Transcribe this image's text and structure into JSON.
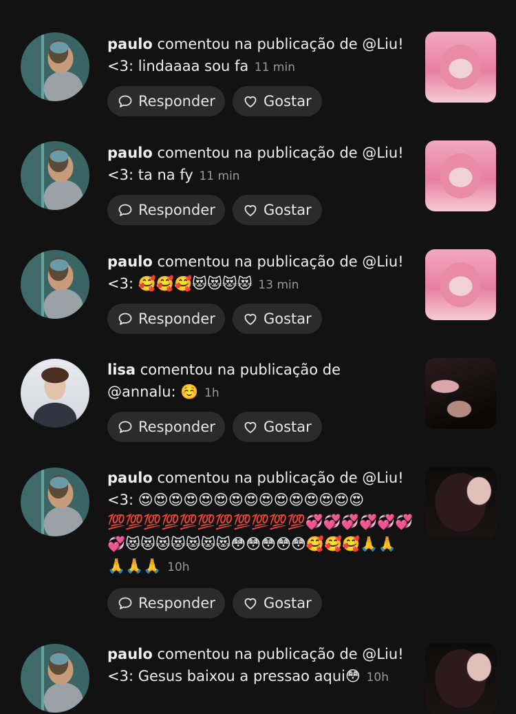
{
  "reply_label": "Responder",
  "like_label": "Gostar",
  "notifications": [
    {
      "user": "paulo",
      "action": "comentou na publicação de @Liu!",
      "comment": "<3: lindaaaa sou fa",
      "time": "11 min",
      "avatar": "paulo",
      "thumb": "pink"
    },
    {
      "user": "paulo",
      "action": "comentou na publicação de @Liu!",
      "comment": "<3: ta na fy",
      "time": "11 min",
      "avatar": "paulo",
      "thumb": "pink"
    },
    {
      "user": "paulo",
      "action": "comentou na publicação de @Liu!",
      "comment": "<3: 🥰🥰🥰😻😻😻😻",
      "time": "13 min",
      "avatar": "paulo",
      "thumb": "pink"
    },
    {
      "user": "lisa",
      "action": "comentou na publicação de",
      "comment": "@annalu: ☺️",
      "time": "1h",
      "avatar": "lisa",
      "thumb": "dark1"
    },
    {
      "user": "paulo",
      "action": "comentou na publicação de @Liu!",
      "comment": "<3: 😍😍😍😍😍😍😍😍😍😍😍😍😍😍😍💯💯💯💯💯💯💯💯💯💯💯💞💞💞💞💞💞💞😻😻😻😻😻😻😻😳😳😳😳😳🥰🥰🥰🙏🙏🙏🙏🙏",
      "time": "10h",
      "avatar": "paulo",
      "thumb": "dark2"
    },
    {
      "user": "paulo",
      "action": "comentou na publicação de @Liu!",
      "comment": "<3: Gesus baixou a pressao aqui😳",
      "time": "10h",
      "avatar": "paulo",
      "thumb": "dark2"
    }
  ]
}
